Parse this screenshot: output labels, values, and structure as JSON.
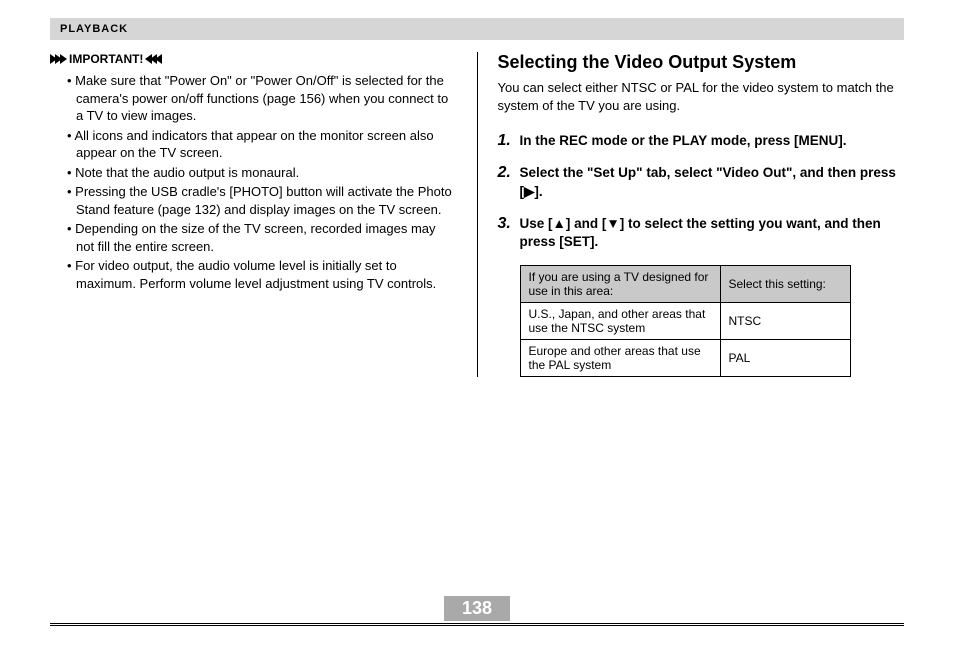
{
  "section_header": "PLAYBACK",
  "left": {
    "important_label": "IMPORTANT!",
    "bullets": [
      "Make sure that \"Power On\" or \"Power On/Off\" is selected for the camera's power on/off functions (page 156) when you connect to a TV to view images.",
      "All icons and indicators that appear on the monitor screen also appear on the TV screen.",
      "Note that the audio output is monaural.",
      "Pressing the USB cradle's [PHOTO] button will activate the Photo Stand feature (page 132) and display images on the TV screen.",
      "Depending on the size of the TV screen, recorded images may not fill the entire screen.",
      "For video output, the audio volume level is initially set to maximum. Perform volume level adjustment using TV controls."
    ]
  },
  "right": {
    "heading": "Selecting the Video Output System",
    "intro": "You can select either NTSC or PAL for the video system to match the system of the TV you are using.",
    "steps": [
      "In the REC mode or the PLAY mode, press [MENU].",
      "Select the \"Set Up\" tab, select \"Video Out\", and then press [▶].",
      "Use [▲] and [▼] to select the setting you want, and then press [SET]."
    ],
    "table": {
      "header": [
        "If you are using a TV designed for use in this area:",
        "Select this setting:"
      ],
      "rows": [
        [
          "U.S., Japan, and other areas that use the NTSC system",
          "NTSC"
        ],
        [
          "Europe and other areas that use the PAL system",
          "PAL"
        ]
      ]
    }
  },
  "page_number": "138"
}
